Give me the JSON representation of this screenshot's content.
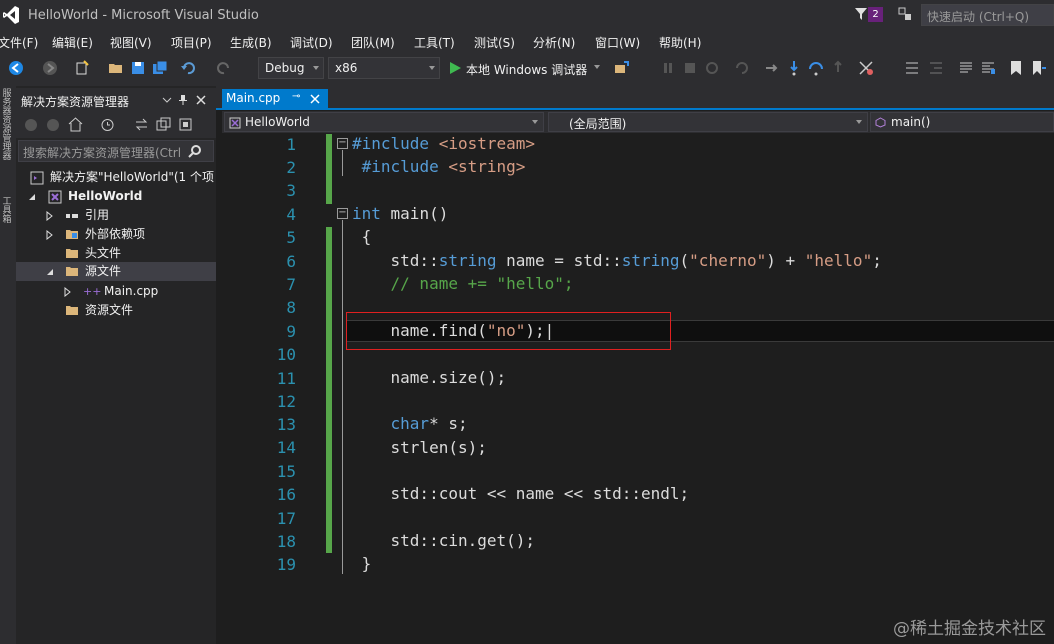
{
  "window": {
    "title": "HelloWorld - Microsoft Visual Studio",
    "notification_count": "2",
    "quick_launch_placeholder": "快速启动 (Ctrl+Q)"
  },
  "menu": [
    "文件(F)",
    "编辑(E)",
    "视图(V)",
    "项目(P)",
    "生成(B)",
    "调试(D)",
    "团队(M)",
    "工具(T)",
    "测试(S)",
    "分析(N)",
    "窗口(W)",
    "帮助(H)"
  ],
  "toolbar": {
    "config": "Debug",
    "platform": "x86",
    "run_label": "本地 Windows 调试器"
  },
  "left_strip": {
    "tab1": "服务器资源管理器",
    "tab2": "工具箱"
  },
  "solution_explorer": {
    "title": "解决方案资源管理器",
    "search_placeholder": "搜索解决方案资源管理器(Ctrl",
    "solution": "解决方案\"HelloWorld\"(1 个项",
    "project": "HelloWorld",
    "items": [
      "引用",
      "外部依赖项",
      "头文件",
      "源文件",
      "Main.cpp",
      "资源文件"
    ]
  },
  "editor": {
    "tab": "Main.cpp",
    "nav_project": "HelloWorld",
    "nav_scope": "(全局范围)",
    "nav_member": "main()",
    "line_numbers": [
      "1",
      "2",
      "3",
      "4",
      "5",
      "6",
      "7",
      "8",
      "9",
      "10",
      "11",
      "12",
      "13",
      "14",
      "15",
      "16",
      "17",
      "18",
      "19"
    ]
  },
  "watermark": "@稀土掘金技术社区",
  "colors": {
    "accent": "#007acc",
    "keyword": "#569cd6",
    "string": "#d69d85",
    "comment": "#57a64a",
    "highlight_box": "#e02020"
  }
}
